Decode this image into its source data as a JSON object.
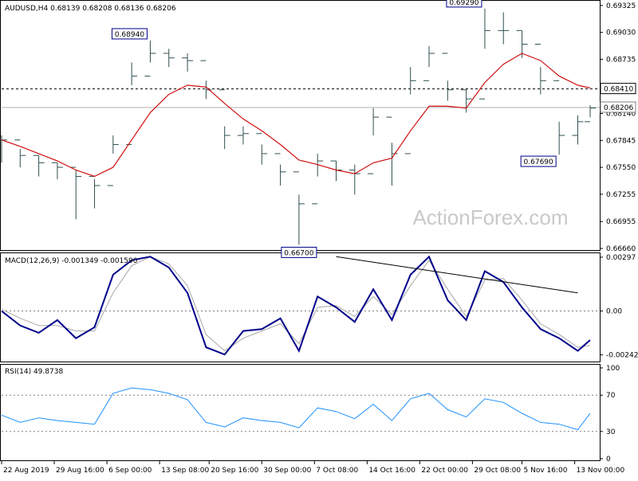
{
  "chart_data": [
    {
      "type": "candlestick",
      "header": "AUDUSD,H4  0.68139 0.68208 0.68136 0.68206",
      "ylim": [
        0.6666,
        0.6935
      ],
      "y_ticks": [
        "0.69325",
        "0.69030",
        "0.68735",
        "0.68140",
        "0.67845",
        "0.67550",
        "0.67255",
        "0.66955",
        "0.66660"
      ],
      "y_tick_values": [
        0.69325,
        0.6903,
        0.68735,
        0.6814,
        0.67845,
        0.6755,
        0.67255,
        0.66955,
        0.6666
      ],
      "x": [
        0,
        6,
        12,
        18,
        24,
        30,
        36,
        42,
        48,
        54,
        60,
        66,
        72,
        78,
        84,
        90,
        96,
        102,
        108,
        114,
        120,
        126,
        132,
        138,
        144,
        150,
        156,
        162,
        168,
        174,
        180,
        186,
        190
      ],
      "close": [
        0.6785,
        0.6768,
        0.676,
        0.6755,
        0.6745,
        0.6735,
        0.678,
        0.6855,
        0.688,
        0.6875,
        0.6872,
        0.684,
        0.679,
        0.6792,
        0.677,
        0.675,
        0.6715,
        0.6762,
        0.6752,
        0.6748,
        0.681,
        0.677,
        0.685,
        0.688,
        0.684,
        0.683,
        0.6905,
        0.6905,
        0.689,
        0.685,
        0.679,
        0.6805,
        0.682
      ],
      "high": [
        0.679,
        0.6775,
        0.6768,
        0.676,
        0.6752,
        0.6742,
        0.679,
        0.687,
        0.6894,
        0.6885,
        0.688,
        0.685,
        0.68,
        0.68,
        0.678,
        0.6758,
        0.6725,
        0.677,
        0.6762,
        0.6758,
        0.682,
        0.6782,
        0.6865,
        0.6888,
        0.685,
        0.6842,
        0.6929,
        0.6925,
        0.6905,
        0.6865,
        0.6805,
        0.6812,
        0.6823
      ],
      "low": [
        0.676,
        0.6755,
        0.6745,
        0.6742,
        0.6698,
        0.671,
        0.677,
        0.6845,
        0.687,
        0.6865,
        0.686,
        0.683,
        0.6775,
        0.678,
        0.6758,
        0.6735,
        0.667,
        0.6745,
        0.674,
        0.6725,
        0.679,
        0.6735,
        0.6835,
        0.6865,
        0.6828,
        0.6815,
        0.6885,
        0.689,
        0.6875,
        0.6835,
        0.6769,
        0.678,
        0.681
      ],
      "ma": [
        0.6785,
        0.6778,
        0.677,
        0.6762,
        0.6752,
        0.6745,
        0.6755,
        0.6785,
        0.6815,
        0.6835,
        0.6845,
        0.6843,
        0.6825,
        0.6808,
        0.6795,
        0.678,
        0.6763,
        0.6758,
        0.6752,
        0.6748,
        0.676,
        0.6765,
        0.6795,
        0.6822,
        0.6822,
        0.682,
        0.6848,
        0.6868,
        0.688,
        0.6872,
        0.6855,
        0.6845,
        0.6842
      ],
      "h_lines": [
        0.6841
      ],
      "price_labels": [
        {
          "text": "0.68410",
          "value": 0.6841
        },
        {
          "text": "0.68206",
          "value": 0.68206
        }
      ],
      "annotations": [
        {
          "text": "0.68940",
          "x": 48,
          "y": 0.6894
        },
        {
          "text": "0.66700",
          "x": 96,
          "y": 0.667
        },
        {
          "text": "0.69290",
          "x": 156,
          "y": 0.6929
        },
        {
          "text": "0.67690",
          "x": 180,
          "y": 0.6769
        }
      ],
      "watermark": "ActionForex.com"
    },
    {
      "type": "line",
      "title": "MACD(12,26,9) -0.001349 -0.001590",
      "ylim": [
        -0.0027,
        0.0031
      ],
      "y_ticks": [
        "0.00297",
        "0.00",
        "-0.00242"
      ],
      "y_tick_values": [
        0.00297,
        0.0,
        -0.00242
      ],
      "x": [
        0,
        6,
        12,
        18,
        24,
        30,
        36,
        42,
        48,
        54,
        60,
        66,
        72,
        78,
        84,
        90,
        96,
        102,
        108,
        114,
        120,
        126,
        132,
        138,
        144,
        150,
        156,
        162,
        168,
        174,
        180,
        186,
        190
      ],
      "macd": [
        0.0,
        -0.0008,
        -0.0012,
        -0.0005,
        -0.0015,
        -0.0009,
        0.002,
        0.0028,
        0.003,
        0.0024,
        0.001,
        -0.002,
        -0.0024,
        -0.0011,
        -0.001,
        -0.0004,
        -0.0022,
        0.0008,
        0.0002,
        -0.0006,
        0.0012,
        -0.0005,
        0.002,
        0.003,
        0.0006,
        -0.0005,
        0.0022,
        0.0016,
        0.0002,
        -0.001,
        -0.0015,
        -0.0022,
        -0.0016
      ],
      "signal": [
        0.0001,
        -0.0004,
        -0.0008,
        -0.0008,
        -0.0011,
        -0.0011,
        0.001,
        0.0025,
        0.003,
        0.0026,
        0.0014,
        -0.0013,
        -0.0022,
        -0.0015,
        -0.0011,
        -0.0007,
        -0.0018,
        0.0002,
        0.0003,
        -0.0003,
        0.0008,
        -0.0002,
        0.0014,
        0.0028,
        0.0012,
        -0.0003,
        0.0017,
        0.0018,
        0.0006,
        -0.0007,
        -0.0013,
        -0.002,
        -0.0019
      ],
      "trendline": [
        [
          108,
          0.003
        ],
        [
          186,
          0.001
        ]
      ]
    },
    {
      "type": "line",
      "title": "RSI(14) 49.8738",
      "ylim": [
        0,
        100
      ],
      "y_ticks": [
        "100",
        "70",
        "30",
        "0"
      ],
      "y_tick_values": [
        100,
        70,
        30,
        0
      ],
      "levels": [
        70,
        30
      ],
      "x": [
        0,
        6,
        12,
        18,
        24,
        30,
        36,
        42,
        48,
        54,
        60,
        66,
        72,
        78,
        84,
        90,
        96,
        102,
        108,
        114,
        120,
        126,
        132,
        138,
        144,
        150,
        156,
        162,
        168,
        174,
        180,
        186,
        190
      ],
      "values": [
        48,
        40,
        45,
        42,
        40,
        38,
        72,
        78,
        76,
        72,
        65,
        40,
        35,
        45,
        42,
        40,
        34,
        56,
        52,
        44,
        60,
        42,
        66,
        72,
        54,
        46,
        66,
        62,
        50,
        40,
        38,
        32,
        49.87
      ]
    }
  ],
  "x_axis": {
    "labels": [
      "22 Aug 2019",
      "29 Aug 16:00",
      "6 Sep 00:00",
      "13 Sep 08:00",
      "20 Sep 16:00",
      "30 Sep 00:00",
      "7 Oct 08:00",
      "14 Oct 16:00",
      "22 Oct 00:00",
      "29 Oct 08:00",
      "5 Nov 16:00",
      "13 Nov 00:00"
    ],
    "positions": [
      0,
      17,
      34,
      51,
      67,
      84,
      101,
      118,
      135,
      152,
      168,
      185
    ],
    "range": [
      0,
      190
    ]
  },
  "colors": {
    "candle": "#2f4f4f",
    "ma": "#d01010",
    "macd": "#00008b",
    "signal": "#a8a8a8",
    "rsi": "#1e90ff",
    "trend": "#000000",
    "grid": "#808080",
    "label_border": "#00008b"
  }
}
